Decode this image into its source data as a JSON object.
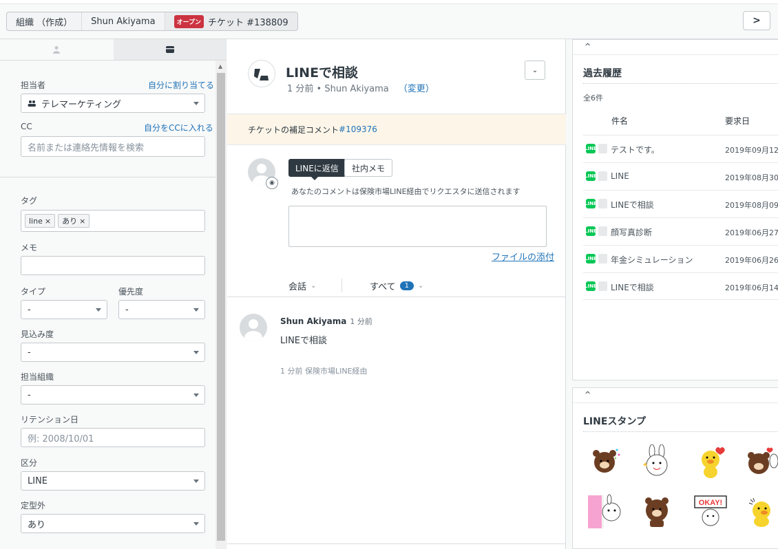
{
  "breadcrumbs": {
    "org": "組織 （作成）",
    "user": "Shun Akiyama",
    "status": "オープン",
    "ticket": "チケット #138809"
  },
  "next_label": ">",
  "left": {
    "assignee_label": "担当者",
    "assign_self": "自分に割り当てる",
    "assignee_value": "テレマーケティング",
    "cc_label": "CC",
    "cc_self": "自分をCCに入れる",
    "cc_placeholder": "名前または連絡先情報を検索",
    "tags_label": "タグ",
    "tags": [
      "line",
      "あり"
    ],
    "memo_label": "メモ",
    "type_label": "タイプ",
    "type_value": "-",
    "priority_label": "優先度",
    "priority_value": "-",
    "prospect_label": "見込み度",
    "prospect_value": "-",
    "group_label": "担当組織",
    "group_value": "-",
    "retention_label": "リテンション日",
    "retention_placeholder": "例: 2008/10/01",
    "category_label": "区分",
    "category_value": "LINE",
    "offtemplate_label": "定型外",
    "offtemplate_value": "あり"
  },
  "center": {
    "title": "LINEで相談",
    "subtitle": "1 分前 • Shun Akiyama",
    "change": "（変更）",
    "notice_text": "チケットの補足コメント",
    "notice_num": "#109376",
    "tab_reply": "LINEに返信",
    "tab_note": "社内メモ",
    "reply_hint": "あなたのコメントは保険市場LINE経由でリクエスタに送信されます",
    "attach": "ファイルの添付",
    "filter_conv": "会話",
    "filter_all": "すべて",
    "filter_count": "1",
    "message": {
      "author": "Shun Akiyama",
      "time": "1 分前",
      "body": "LINEで相談",
      "meta": "1 分前 保険市場LINE経由"
    }
  },
  "history": {
    "collapse": "^",
    "title": "過去履歴",
    "count": "全6件",
    "col_subject": "件名",
    "col_date": "要求日",
    "rows": [
      {
        "subject": "テストです。",
        "date": "2019年09月12"
      },
      {
        "subject": "LINE",
        "date": "2019年08月30"
      },
      {
        "subject": "LINEで相談",
        "date": "2019年08月09"
      },
      {
        "subject": "顔写真診断",
        "date": "2019年06月27"
      },
      {
        "subject": "年金シミュレーション",
        "date": "2019年06月26"
      },
      {
        "subject": "LINEで相談",
        "date": "2019年06月14"
      }
    ]
  },
  "stamps": {
    "collapse": "^",
    "title": "LINEスタンプ",
    "okay_text": "OKAY!"
  },
  "colors": {
    "line_green": "#06c755",
    "open_badge": "#cc3340",
    "link_blue": "#1f73b7"
  }
}
